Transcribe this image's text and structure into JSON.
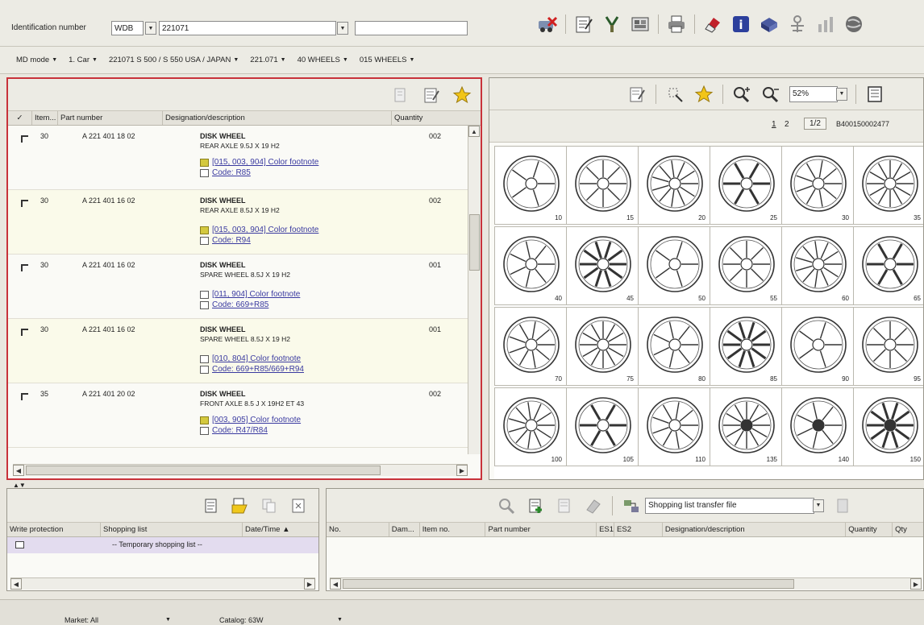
{
  "top": {
    "id_label": "Identification number",
    "id_prefix": "WDB",
    "id_value": "221071",
    "id_extra": ""
  },
  "filters": [
    {
      "label": "MD mode"
    },
    {
      "label": "1. Car"
    },
    {
      "label": "221071 S 500 / S 550 USA / JAPAN"
    },
    {
      "label": "221.071"
    },
    {
      "label": "40 WHEELS"
    },
    {
      "label": "015 WHEELS"
    }
  ],
  "parts": {
    "columns": [
      "✓",
      "Item...",
      "Part number",
      "Designation/description",
      "Quantity"
    ],
    "rows": [
      {
        "item": "30",
        "part": "A 221 401 18 02",
        "title": "DISK WHEEL",
        "sub": "REAR AXLE 9.5J X 19 H2",
        "footnote": "[015, 003, 904] Color footnote",
        "code": "Code: R85",
        "qty": "002"
      },
      {
        "item": "30",
        "part": "A 221 401 16 02",
        "title": "DISK WHEEL",
        "sub": "REAR AXLE 8.5J X 19 H2",
        "footnote": "[015, 003, 904] Color footnote",
        "code": "Code: R94",
        "qty": "002"
      },
      {
        "item": "30",
        "part": "A 221 401 16 02",
        "title": "DISK WHEEL",
        "sub": "SPARE WHEEL 8.5J X 19 H2",
        "footnote": "[011, 904] Color footnote",
        "code": "Code: 669+R85",
        "qty": "001"
      },
      {
        "item": "30",
        "part": "A 221 401 16 02",
        "title": "DISK WHEEL",
        "sub": "SPARE WHEEL 8.5J X 19 H2",
        "footnote": "[010, 804] Color footnote",
        "code": "Code: 669+R85/669+R94",
        "qty": "001"
      },
      {
        "item": "35",
        "part": "A 221 401 20 02",
        "title": "DISK WHEEL",
        "sub": "FRONT AXLE 8.5 J X 19H2 ET 43",
        "footnote": "[003, 905] Color footnote",
        "code": "Code: R47/R84",
        "qty": "002"
      }
    ]
  },
  "viewer": {
    "zoom": "52%",
    "page1": "1",
    "page2": "2",
    "page_of": "1/2",
    "doc_id": "B400150002477",
    "wheels": [
      "10",
      "15",
      "20",
      "25",
      "30",
      "35",
      "40",
      "45",
      "50",
      "55",
      "60",
      "65",
      "70",
      "75",
      "80",
      "85",
      "90",
      "95",
      "100",
      "105",
      "110",
      "135",
      "140",
      "150"
    ]
  },
  "shopping": {
    "columns": [
      "Write protection",
      "Shopping list",
      "Date/Time ▲"
    ],
    "temp_row": "-- Temporary shopping list --"
  },
  "basket": {
    "transfer_label": "Shopping list transfer file",
    "columns": [
      "No.",
      "Dam...",
      "Item no.",
      "Part number",
      "ES1",
      "ES2",
      "Designation/description",
      "Quantity",
      "Qty"
    ]
  },
  "status": {
    "market": "Market: All",
    "catalog": "Catalog: 63W"
  }
}
